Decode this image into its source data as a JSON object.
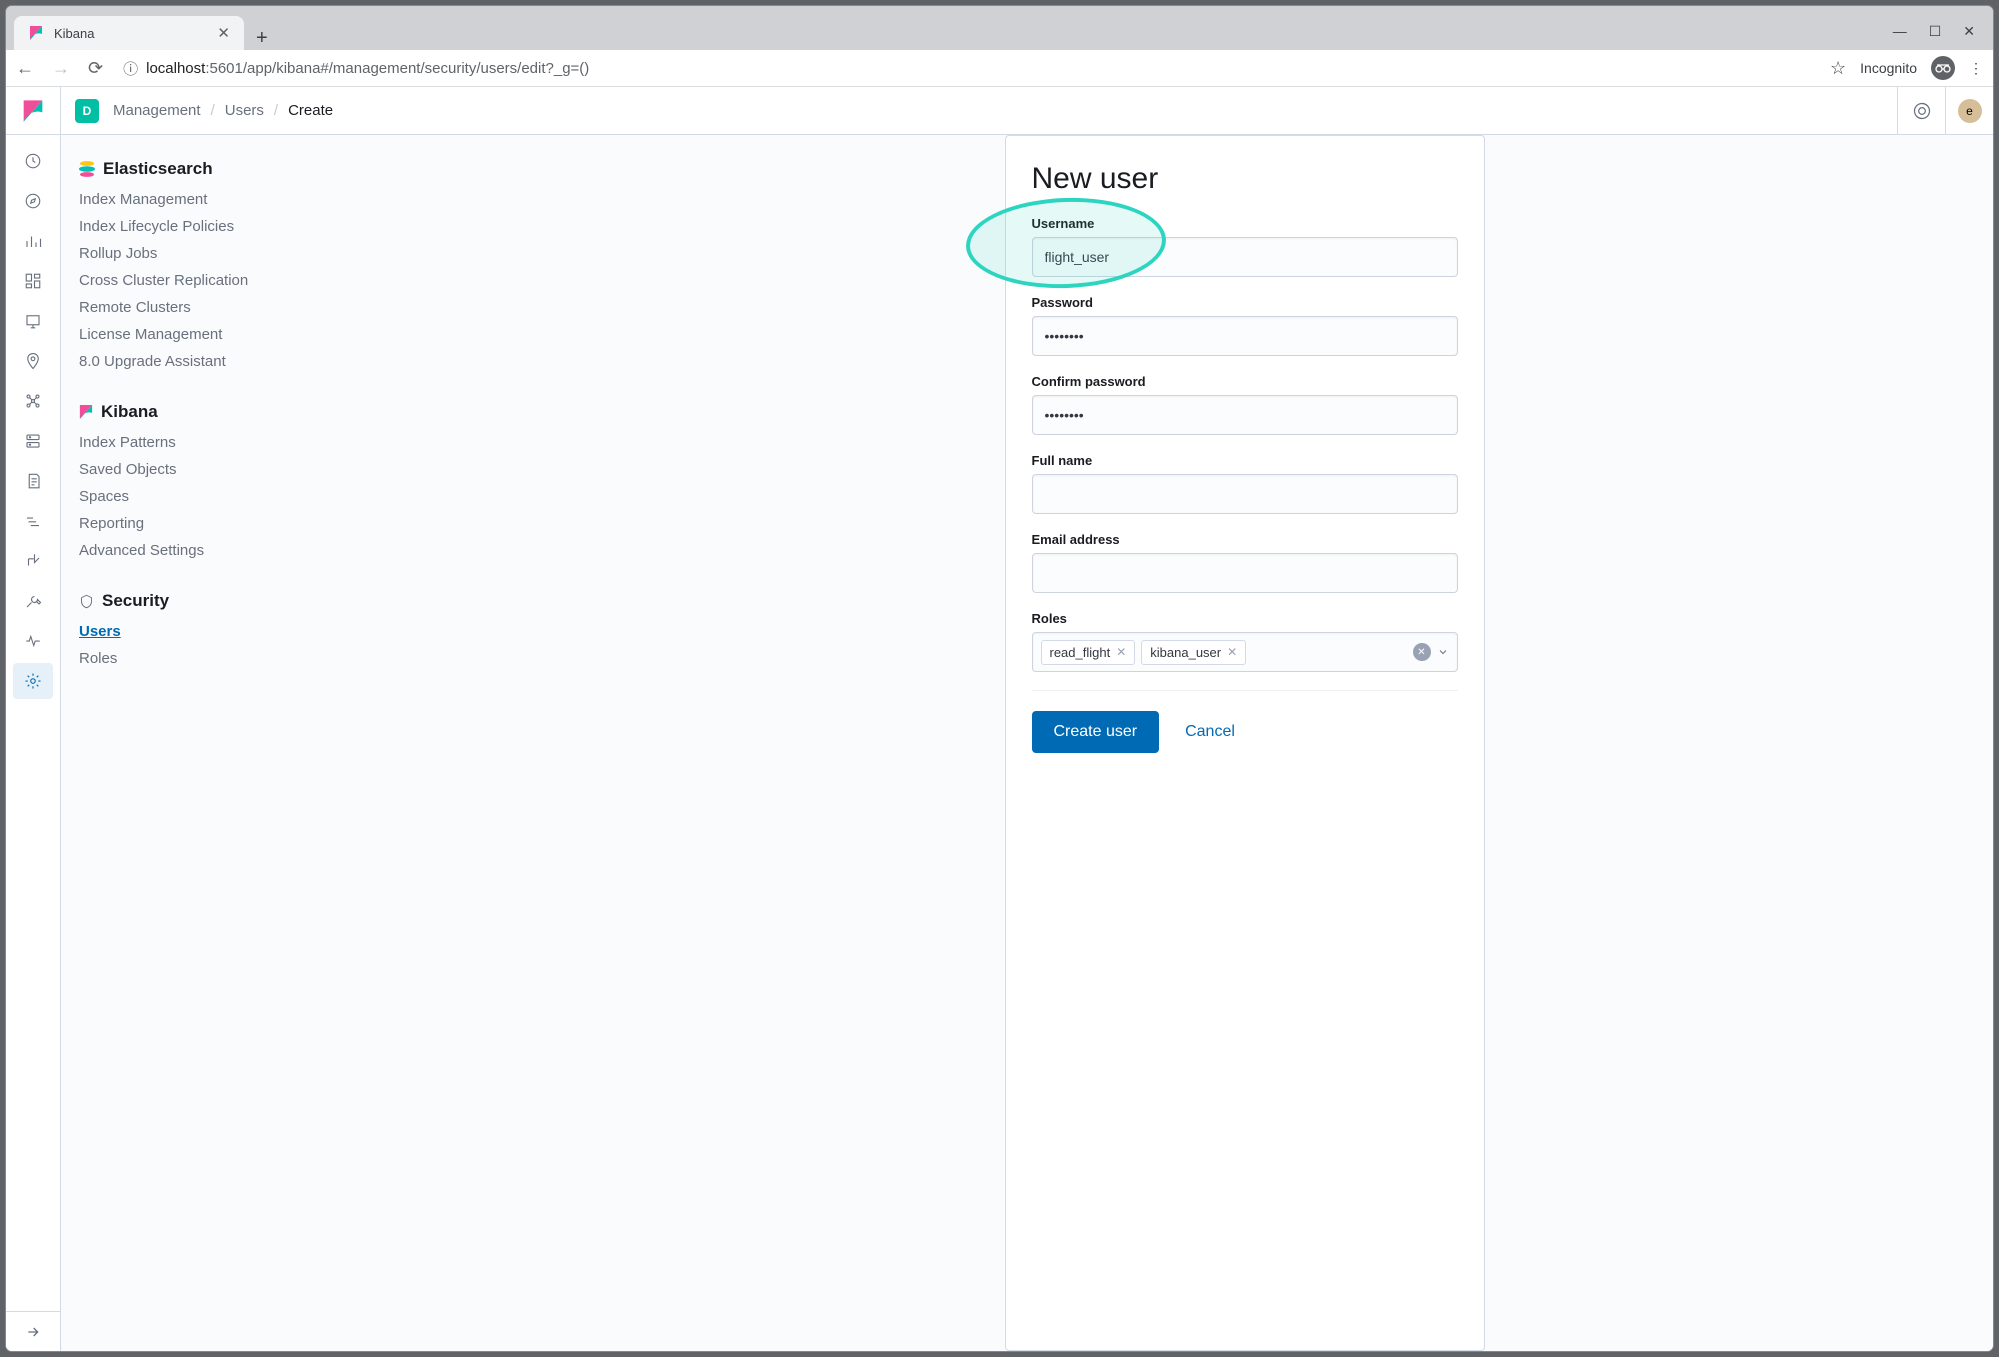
{
  "browser": {
    "tab_title": "Kibana",
    "url_host": "localhost",
    "url_port_path": ":5601/app/kibana#/management/security/users/edit?_g=()",
    "incognito_label": "Incognito"
  },
  "header": {
    "space_letter": "D",
    "breadcrumbs": [
      "Management",
      "Users",
      "Create"
    ],
    "avatar_letter": "e"
  },
  "sidebar": {
    "groups": [
      {
        "title": "Elasticsearch",
        "items": [
          "Index Management",
          "Index Lifecycle Policies",
          "Rollup Jobs",
          "Cross Cluster Replication",
          "Remote Clusters",
          "License Management",
          "8.0 Upgrade Assistant"
        ]
      },
      {
        "title": "Kibana",
        "items": [
          "Index Patterns",
          "Saved Objects",
          "Spaces",
          "Reporting",
          "Advanced Settings"
        ]
      },
      {
        "title": "Security",
        "items": [
          "Users",
          "Roles"
        ],
        "active": "Users"
      }
    ]
  },
  "form": {
    "title": "New user",
    "fields": {
      "username": {
        "label": "Username",
        "value": "flight_user"
      },
      "password": {
        "label": "Password",
        "value": "••••••••"
      },
      "confirm_password": {
        "label": "Confirm password",
        "value": "••••••••"
      },
      "full_name": {
        "label": "Full name",
        "value": ""
      },
      "email": {
        "label": "Email address",
        "value": ""
      },
      "roles": {
        "label": "Roles",
        "values": [
          "read_flight",
          "kibana_user"
        ]
      }
    },
    "actions": {
      "create": "Create user",
      "cancel": "Cancel"
    }
  }
}
